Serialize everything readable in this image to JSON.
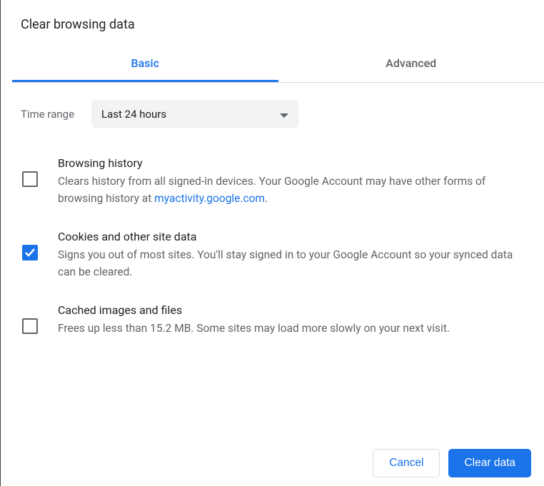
{
  "dialog": {
    "title": "Clear browsing data"
  },
  "tabs": {
    "basic": "Basic",
    "advanced": "Advanced"
  },
  "time_range": {
    "label": "Time range",
    "value": "Last 24 hours"
  },
  "options": {
    "browsing_history": {
      "title": "Browsing history",
      "desc_before": "Clears history from all signed-in devices. Your Google Account may have other forms of browsing history at ",
      "link_text": "myactivity.google.com",
      "desc_after": ".",
      "checked": false
    },
    "cookies": {
      "title": "Cookies and other site data",
      "desc": "Signs you out of most sites. You'll stay signed in to your Google Account so your synced data can be cleared.",
      "checked": true
    },
    "cache": {
      "title": "Cached images and files",
      "desc": "Frees up less than 15.2 MB. Some sites may load more slowly on your next visit.",
      "checked": false
    }
  },
  "buttons": {
    "cancel": "Cancel",
    "clear": "Clear data"
  }
}
